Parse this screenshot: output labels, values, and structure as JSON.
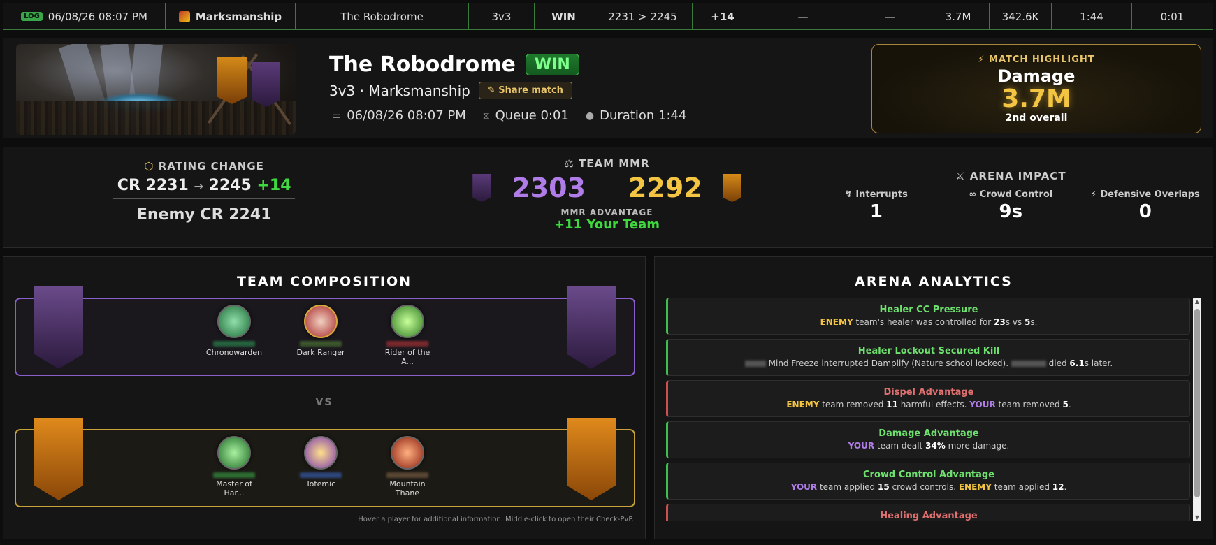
{
  "log_row": {
    "badge": "LOG",
    "datetime": "06/08/26 08:07 PM",
    "spec": "Marksmanship",
    "arena": "The Robodrome",
    "bracket": "3v3",
    "result": "WIN",
    "rating": "2231 > 2245",
    "rating_change": "+14",
    "col_a": "—",
    "col_b": "—",
    "damage": "3.7M",
    "healing": "342.6K",
    "duration": "1:44",
    "queue": "0:01"
  },
  "header": {
    "arena_name": "The Robodrome",
    "result": "WIN",
    "subtitle": "3v3 · Marksmanship",
    "share_label": "Share match",
    "date": "06/08/26 08:07 PM",
    "queue": "Queue 0:01",
    "duration": "Duration 1:44",
    "highlight": {
      "tag": "MATCH HIGHLIGHT",
      "title": "Damage",
      "value": "3.7M",
      "sub": "2nd overall"
    }
  },
  "rating": {
    "heading": "RATING CHANGE",
    "cr_label": "CR",
    "cr_before": "2231",
    "arrow": "→",
    "cr_after": "2245",
    "cr_change": "+14",
    "enemy_label": "Enemy CR",
    "enemy_cr": "2241"
  },
  "mmr": {
    "heading": "TEAM MMR",
    "team_mmr": "2303",
    "enemy_mmr": "2292",
    "adv_label": "MMR ADVANTAGE",
    "adv_value": "+11 Your Team"
  },
  "impact": {
    "heading": "ARENA IMPACT",
    "items": [
      {
        "label": "Interrupts",
        "value": "1"
      },
      {
        "label": "Crowd Control",
        "value": "9s"
      },
      {
        "label": "Defensive Overlaps",
        "value": "0"
      }
    ]
  },
  "composition": {
    "title": "TEAM COMPOSITION",
    "vs": "VS",
    "team": [
      {
        "name": "Chronowarden",
        "color": "#2fa05a"
      },
      {
        "name": "Dark Ranger",
        "color": "#c8383a"
      },
      {
        "name": "Rider of the A...",
        "color": "#5ad04a"
      }
    ],
    "enemy": [
      {
        "name": "Master of Har...",
        "color": "#3ab04a"
      },
      {
        "name": "Totemic",
        "color": "#8a5ad0"
      },
      {
        "name": "Mountain Thane",
        "color": "#c84a20"
      }
    ],
    "hint": "Hover a player for additional information. Middle-click to open their Check-PvP."
  },
  "analytics": {
    "title": "ARENA ANALYTICS",
    "cards": [
      {
        "title": "Healer CC Pressure"
      },
      {
        "title": "Healer Lockout Secured Kill"
      },
      {
        "title": "Dispel Advantage"
      },
      {
        "title": "Damage Advantage"
      },
      {
        "title": "Crowd Control Advantage"
      },
      {
        "title": "Healing Advantage"
      }
    ],
    "c0": {
      "who": "ENEMY",
      "t1": " team's healer was controlled for ",
      "v1": "23",
      "t2": "s vs ",
      "v2": "5",
      "t3": "s."
    },
    "c1": {
      "t1": " Mind Freeze interrupted Damplify (Nature school locked). ",
      "t2": " died ",
      "v1": "6.1",
      "t3": "s later."
    },
    "c2": {
      "who1": "ENEMY",
      "t1": " team removed ",
      "v1": "11",
      "t2": " harmful effects. ",
      "who2": "YOUR",
      "t3": " team removed ",
      "v2": "5",
      "t4": "."
    },
    "c3": {
      "who": "YOUR",
      "t1": " team dealt ",
      "v1": "34%",
      "t2": " more damage."
    },
    "c4": {
      "who1": "YOUR",
      "t1": " team applied ",
      "v1": "15",
      "t2": " crowd controls. ",
      "who2": "ENEMY",
      "t3": " team applied ",
      "v2": "12",
      "t4": "."
    }
  },
  "colors": {
    "win_green": "#3fd83f",
    "team_purple": "#b07de8",
    "enemy_gold": "#f4c542",
    "border_green": "#3a7a3a"
  }
}
